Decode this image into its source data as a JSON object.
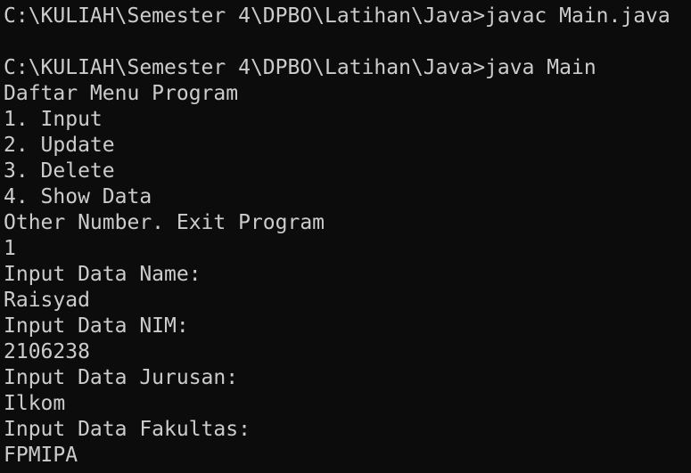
{
  "terminal": {
    "lines": [
      "C:\\KULIAH\\Semester 4\\DPBO\\Latihan\\Java>javac Main.java",
      "",
      "C:\\KULIAH\\Semester 4\\DPBO\\Latihan\\Java>java Main",
      "Daftar Menu Program",
      "1. Input",
      "2. Update",
      "3. Delete",
      "4. Show Data",
      "Other Number. Exit Program",
      "1",
      "Input Data Name:",
      "Raisyad",
      "Input Data NIM:",
      "2106238",
      "Input Data Jurusan:",
      "Ilkom",
      "Input Data Fakultas:",
      "FPMIPA"
    ],
    "colors": {
      "background": "#0c0c0c",
      "foreground": "#cccccc"
    }
  }
}
